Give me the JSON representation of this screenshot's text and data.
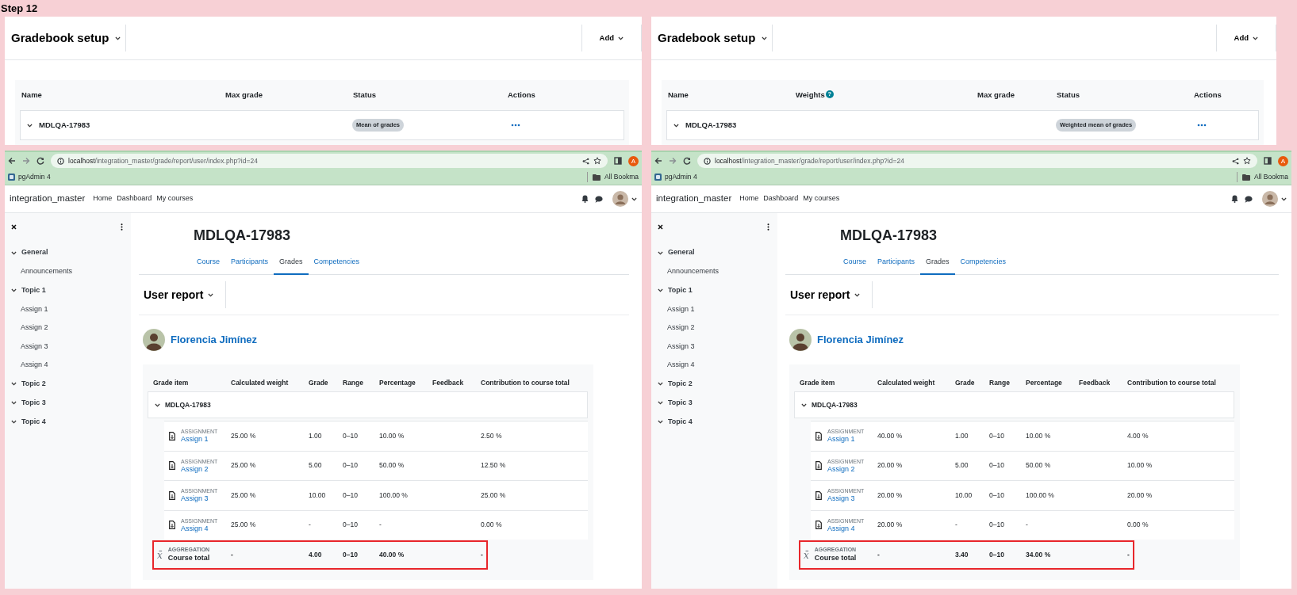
{
  "step_title": "Step 12",
  "panes": [
    {
      "gradebook": {
        "title": "Gradebook setup",
        "add_button": "Add",
        "columns": [
          {
            "label": "Name"
          },
          {
            "label": "Max grade"
          },
          {
            "label": "Status"
          },
          {
            "label": "Actions"
          }
        ],
        "row": {
          "name": "MDLQA-17983",
          "status": "Mean of grades"
        }
      },
      "browser": {
        "url": "**localhost**/integration_master/grade/report/user/index.php?id=24",
        "profile": "A",
        "bookmarks": [
          {
            "label": "pgAdmin 4"
          }
        ],
        "all_bookmarks": "All Bookma",
        "site_name": "integration_master",
        "nav_links": [
          "Home",
          "Dashboard",
          "My courses"
        ],
        "sidebar": [
          {
            "label": "General",
            "children": [
              {
                "label": "Announcements"
              }
            ]
          },
          {
            "label": "Topic 1",
            "children": [
              {
                "label": "Assign 1"
              },
              {
                "label": "Assign 2"
              },
              {
                "label": "Assign 3"
              },
              {
                "label": "Assign 4"
              }
            ]
          },
          {
            "label": "Topic 2"
          },
          {
            "label": "Topic 3"
          },
          {
            "label": "Topic 4"
          }
        ],
        "course_title": "MDLQA-17983",
        "tabs": [
          {
            "label": "Course",
            "selected": false
          },
          {
            "label": "Participants",
            "selected": false
          },
          {
            "label": "Grades",
            "selected": true
          },
          {
            "label": "Competencies",
            "selected": false
          }
        ],
        "report_selector": "User report",
        "user_name": "Florencia Jimínez",
        "grade_table": {
          "columns": [
            "Grade item",
            "Calculated weight",
            "Grade",
            "Range",
            "Percentage",
            "Feedback",
            "Contribution to course total"
          ],
          "category": "MDLQA-17983",
          "items": [
            {
              "type": "ASSIGNMENT",
              "name": "Assign 1",
              "weight": "25.00 %",
              "grade": "1.00",
              "range": "0–10",
              "percentage": "10.00 %",
              "contribution": "2.50 %"
            },
            {
              "type": "ASSIGNMENT",
              "name": "Assign 2",
              "weight": "25.00 %",
              "grade": "5.00",
              "range": "0–10",
              "percentage": "50.00 %",
              "contribution": "12.50 %"
            },
            {
              "type": "ASSIGNMENT",
              "name": "Assign 3",
              "weight": "25.00 %",
              "grade": "10.00",
              "range": "0–10",
              "percentage": "100.00 %",
              "contribution": "25.00 %"
            },
            {
              "type": "ASSIGNMENT",
              "name": "Assign 4",
              "weight": "25.00 %",
              "grade": "-",
              "range": "0–10",
              "percentage": "-",
              "contribution": "0.00 %"
            }
          ],
          "total": {
            "symbol": "x̄",
            "type": "AGGREGATION",
            "name": "Course total",
            "weight": "-",
            "grade": "4.00",
            "range": "0–10",
            "percentage": "40.00 %",
            "contribution": "-",
            "highlighted": true
          }
        }
      }
    },
    {
      "gradebook": {
        "title": "Gradebook setup",
        "add_button": "Add",
        "columns": [
          {
            "label": "Name"
          },
          {
            "label": "Weights",
            "help": "?"
          },
          {
            "label": "Max grade"
          },
          {
            "label": "Status"
          },
          {
            "label": "Actions"
          }
        ],
        "row": {
          "name": "MDLQA-17983",
          "status": "Weighted mean of grades"
        }
      },
      "browser": {
        "url": "**localhost**/integration_master/grade/report/user/index.php?id=24",
        "profile": "A",
        "bookmarks": [
          {
            "label": "pgAdmin 4"
          }
        ],
        "all_bookmarks": "All Bookma",
        "site_name": "integration_master",
        "nav_links": [
          "Home",
          "Dashboard",
          "My courses"
        ],
        "sidebar": [
          {
            "label": "General",
            "children": [
              {
                "label": "Announcements"
              }
            ]
          },
          {
            "label": "Topic 1",
            "children": [
              {
                "label": "Assign 1"
              },
              {
                "label": "Assign 2"
              },
              {
                "label": "Assign 3"
              },
              {
                "label": "Assign 4"
              }
            ]
          },
          {
            "label": "Topic 2"
          },
          {
            "label": "Topic 3"
          },
          {
            "label": "Topic 4"
          }
        ],
        "course_title": "MDLQA-17983",
        "tabs": [
          {
            "label": "Course",
            "selected": false
          },
          {
            "label": "Participants",
            "selected": false
          },
          {
            "label": "Grades",
            "selected": true
          },
          {
            "label": "Competencies",
            "selected": false
          }
        ],
        "report_selector": "User report",
        "user_name": "Florencia Jimínez",
        "grade_table": {
          "columns": [
            "Grade item",
            "Calculated weight",
            "Grade",
            "Range",
            "Percentage",
            "Feedback",
            "Contribution to course total"
          ],
          "category": "MDLQA-17983",
          "items": [
            {
              "type": "ASSIGNMENT",
              "name": "Assign 1",
              "weight": "40.00 %",
              "grade": "1.00",
              "range": "0–10",
              "percentage": "10.00 %",
              "contribution": "4.00 %"
            },
            {
              "type": "ASSIGNMENT",
              "name": "Assign 2",
              "weight": "20.00 %",
              "grade": "5.00",
              "range": "0–10",
              "percentage": "50.00 %",
              "contribution": "10.00 %"
            },
            {
              "type": "ASSIGNMENT",
              "name": "Assign 3",
              "weight": "20.00 %",
              "grade": "10.00",
              "range": "0–10",
              "percentage": "100.00 %",
              "contribution": "20.00 %"
            },
            {
              "type": "ASSIGNMENT",
              "name": "Assign 4",
              "weight": "20.00 %",
              "grade": "-",
              "range": "0–10",
              "percentage": "-",
              "contribution": "0.00 %"
            }
          ],
          "total": {
            "symbol": "x̄",
            "type": "AGGREGATION",
            "name": "Course total",
            "weight": "-",
            "grade": "3.40",
            "range": "0–10",
            "percentage": "34.00 %",
            "contribution": "-",
            "highlighted": true
          }
        }
      }
    }
  ]
}
